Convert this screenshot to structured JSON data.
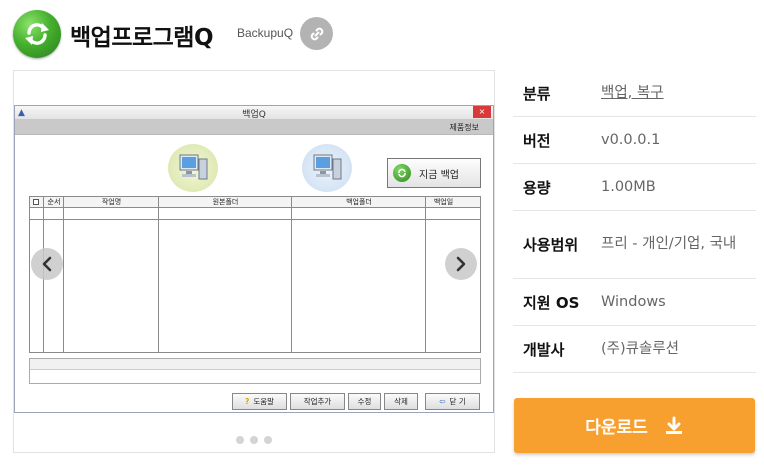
{
  "app": {
    "title": "백업프로그램Q",
    "subtitle": "BackupuQ",
    "icon": "sync-arrows-icon",
    "link_icon": "link-icon"
  },
  "screenshot": {
    "window_title": "백업Q",
    "close_label": "×",
    "menu_item": "제품정보",
    "now_backup_label": "지금 백업",
    "columns": [
      "순서",
      "작업명",
      "원본폴더",
      "백업폴더",
      "백업일"
    ],
    "buttons": [
      {
        "label": "도움말",
        "icon": "help-icon"
      },
      {
        "label": "작업추가",
        "icon": ""
      },
      {
        "label": "수정",
        "icon": ""
      },
      {
        "label": "삭제",
        "icon": ""
      },
      {
        "label": "닫 기",
        "icon": "exit-icon"
      }
    ]
  },
  "carousel": {
    "prev_icon": "chevron-left-icon",
    "next_icon": "chevron-right-icon",
    "dot_count": 3
  },
  "info": {
    "category_label": "분류",
    "category_value": "백업, 복구",
    "version_label": "버전",
    "version_value": "v0.0.0.1",
    "size_label": "용량",
    "size_value": "1.00MB",
    "license_label": "사용범위",
    "license_value": "프리 - 개인/기업, 국내",
    "os_label": "지원 OS",
    "os_value": "Windows",
    "dev_label": "개발사",
    "dev_value": "(주)큐솔루션"
  },
  "download": {
    "label": "다운로드",
    "icon": "download-icon",
    "color": "#f7a030"
  }
}
